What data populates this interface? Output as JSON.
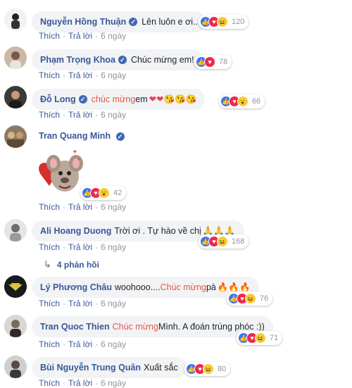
{
  "comments": [
    {
      "author": "Nguyễn Hồng Thuận",
      "text": "Lên luôn e ơi..",
      "reactions": "120"
    },
    {
      "author": "Phạm Trọng Khoa",
      "text": "Chúc mừng em!",
      "reactions": "78"
    },
    {
      "author": "Đỗ Long",
      "highlight": "chúc mừng",
      "text": " em ",
      "emoji": "❤❤😘😘😘",
      "reactions": "66"
    },
    {
      "author": "Tran Quang Minh",
      "reactions": "42"
    },
    {
      "author": "Ali Hoang Duong",
      "text": "Trời ơi . Tự hào về chị ",
      "emoji": "🙏🙏🙏",
      "reactions": "168"
    },
    {
      "author": "Lý Phương Châu",
      "text": "woohooo.... ",
      "highlight": "Chúc mừng",
      "text2": " pà ",
      "emoji": "🔥🔥🔥",
      "reactions": "76"
    },
    {
      "author": "Tran Quoc Thien",
      "highlight": "Chúc mừng",
      "text": " Mình. A đoán trúng phóc :))",
      "reactions": "71"
    },
    {
      "author": "Bùi Nguyễn Trung Quân",
      "text": "Xuất sắc",
      "reactions": "80"
    }
  ],
  "actions": {
    "like": "Thích",
    "reply": "Trả lời",
    "time": "6 ngày",
    "sep": "·"
  },
  "replies_link": "4 phản hồi",
  "colors": {
    "link": "#385898",
    "highlight": "#e9573f",
    "bubble": "#f2f3f5"
  }
}
